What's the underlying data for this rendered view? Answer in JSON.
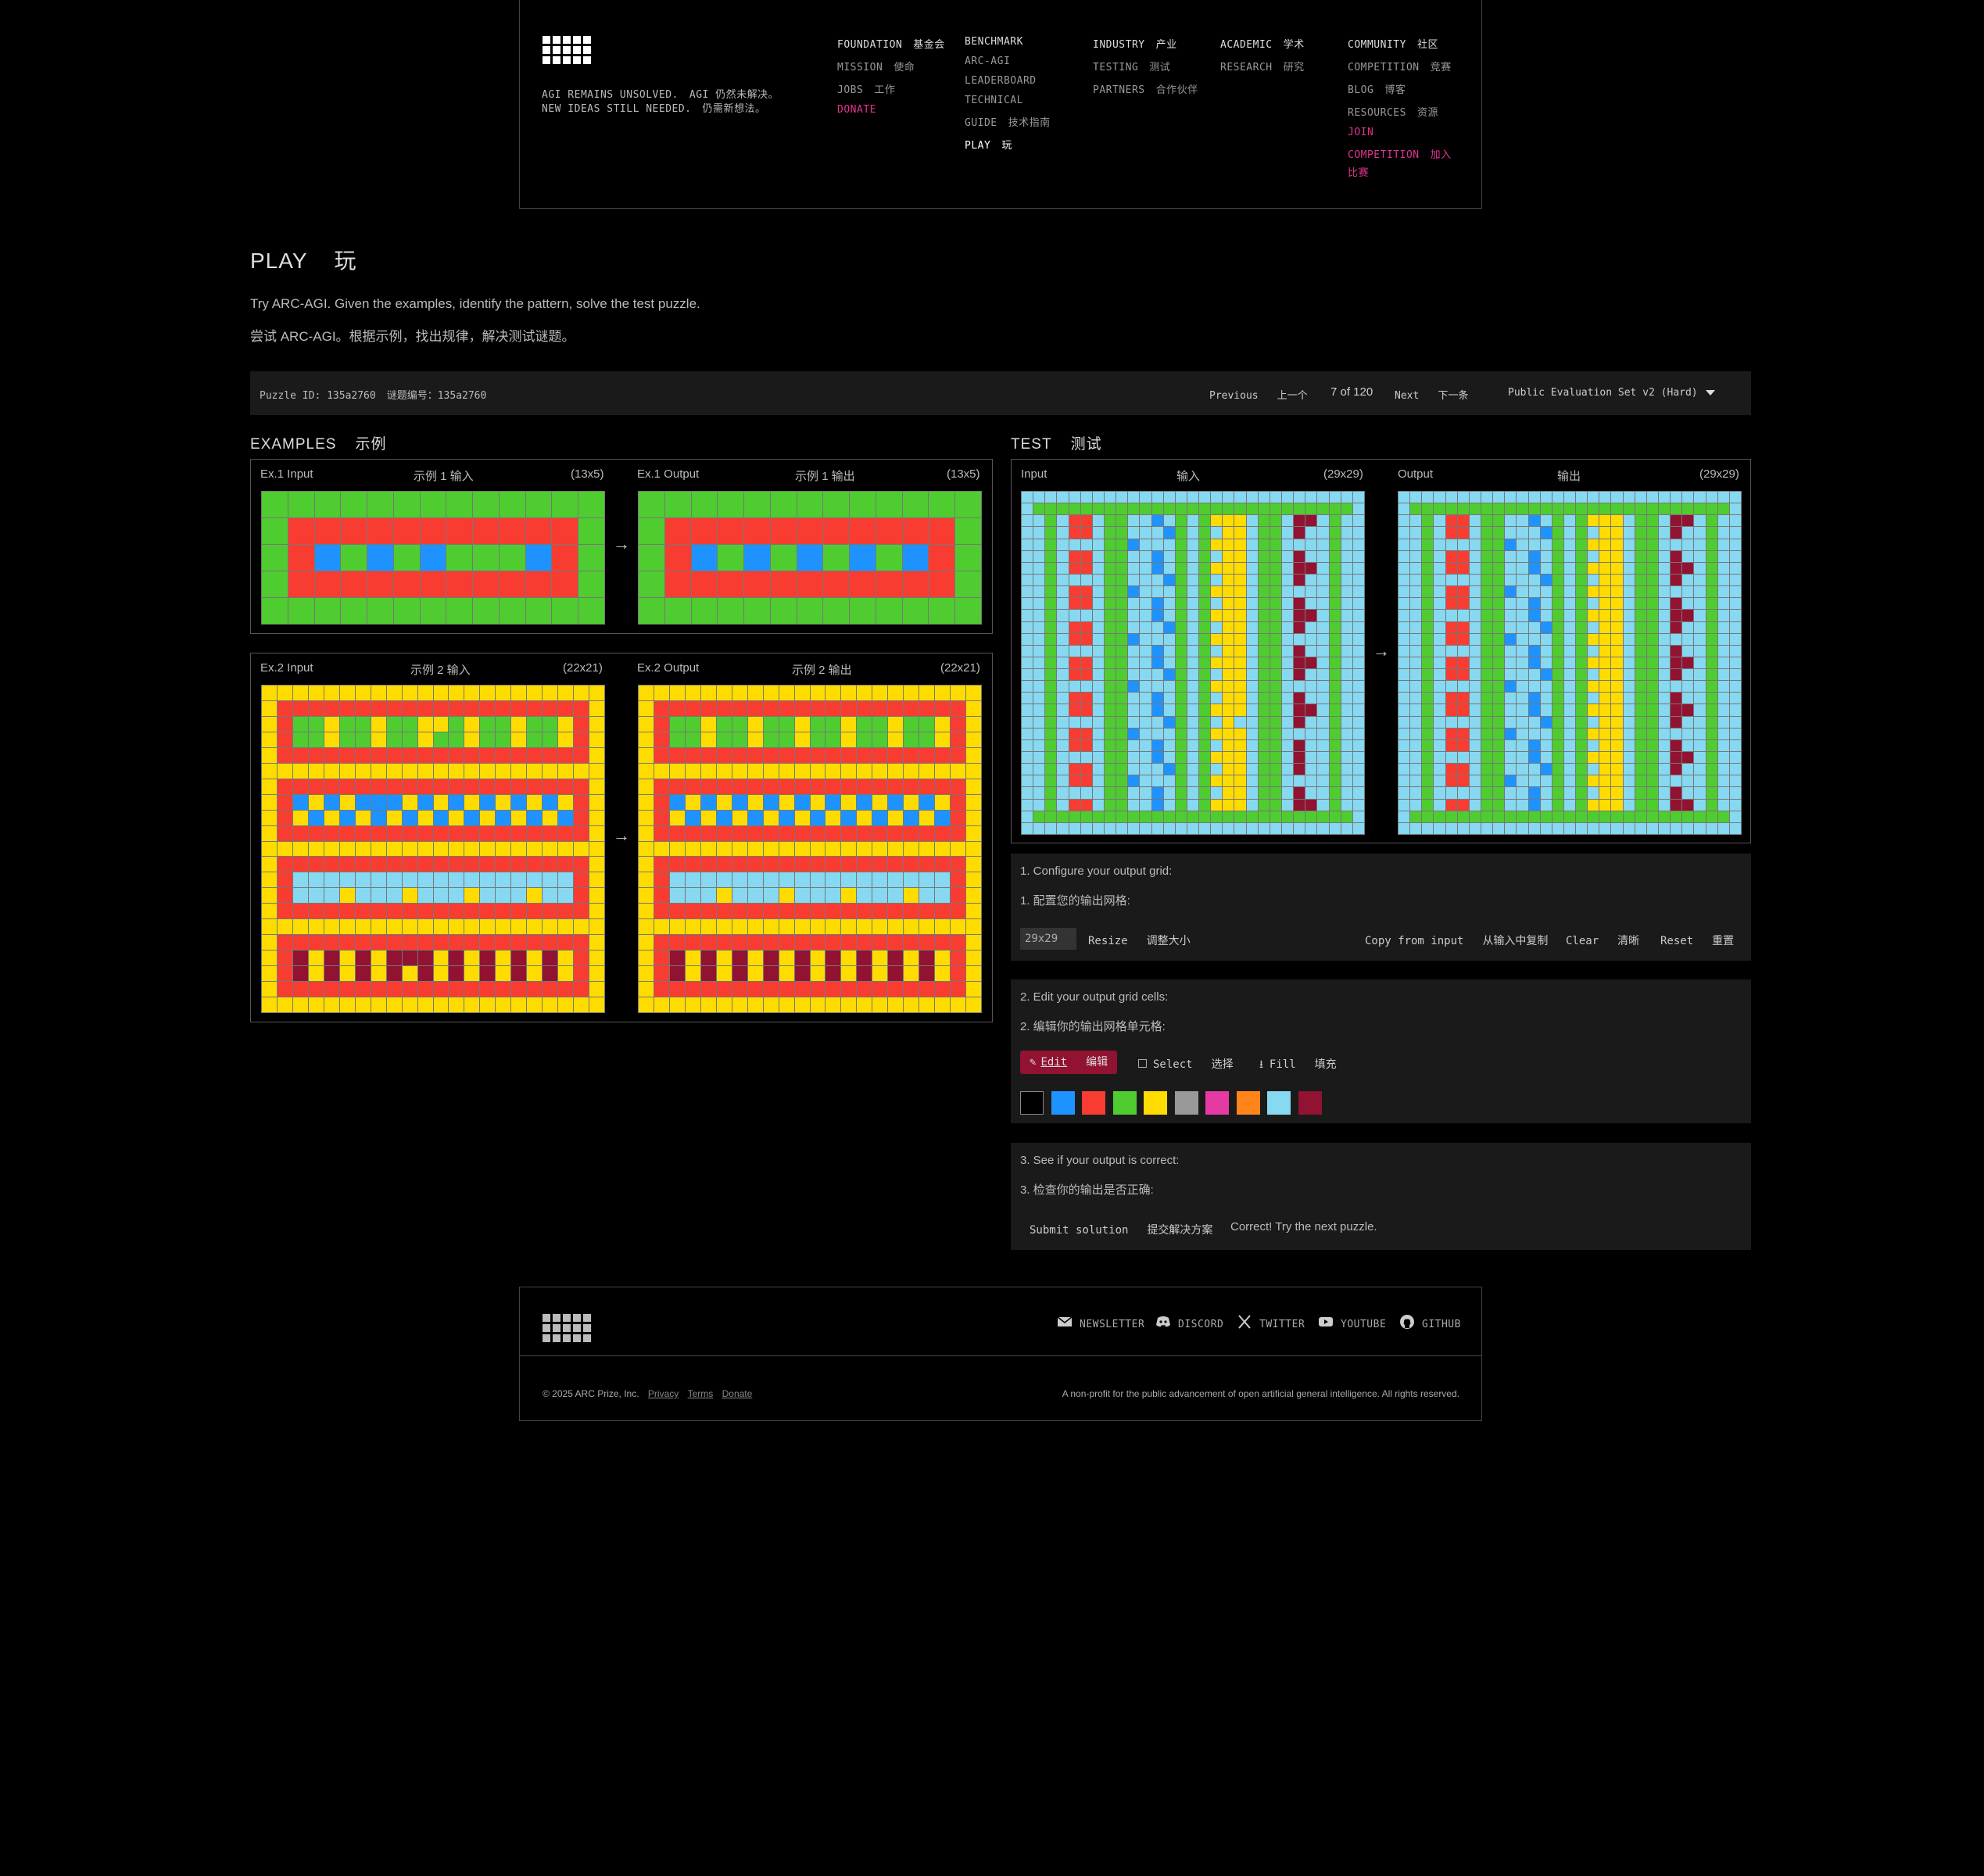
{
  "header": {
    "tagline_en_1": "AGI REMAINS UNSOLVED.",
    "tagline_zh_1": "AGI 仍然未解决。",
    "tagline_en_2": "NEW IDEAS STILL NEEDED.",
    "tagline_zh_2": "仍需新想法。",
    "nav": [
      {
        "heading": "FOUNDATION",
        "heading_zh": "基金会",
        "items": [
          {
            "label": "MISSION",
            "zh": "使命"
          },
          {
            "label": "JOBS",
            "zh": "工作"
          },
          {
            "label": "DONATE",
            "zh": ""
          }
        ]
      },
      {
        "heading": "BENCHMARK",
        "heading_zh": "",
        "items": [
          {
            "label": "ARC-AGI",
            "zh": ""
          },
          {
            "label": "LEADERBOARD",
            "zh": ""
          },
          {
            "label": "TECHNICAL",
            "zh": ""
          },
          {
            "label": "GUIDE",
            "zh": "技术指南"
          },
          {
            "label": "PLAY",
            "zh": "玩"
          }
        ]
      },
      {
        "heading": "INDUSTRY",
        "heading_zh": "产业",
        "items": [
          {
            "label": "TESTING",
            "zh": "测试"
          },
          {
            "label": "PARTNERS",
            "zh": "合作伙伴"
          }
        ]
      },
      {
        "heading": "ACADEMIC",
        "heading_zh": "学术",
        "items": [
          {
            "label": "RESEARCH",
            "zh": "研究"
          }
        ]
      },
      {
        "heading": "COMMUNITY",
        "heading_zh": "社区",
        "items": [
          {
            "label": "COMPETITION",
            "zh": "竞赛"
          },
          {
            "label": "BLOG",
            "zh": "博客"
          },
          {
            "label": "RESOURCES",
            "zh": "资源"
          },
          {
            "label": "JOIN",
            "zh": ""
          },
          {
            "label": "COMPETITION",
            "zh": "加入"
          },
          {
            "label": "比赛",
            "zh": ""
          }
        ]
      }
    ]
  },
  "page": {
    "title": "PLAY",
    "title_zh": "玩",
    "desc_en": "Try ARC-AGI. Given the examples, identify the pattern, solve the test puzzle.",
    "desc_zh": "尝试 ARC-AGI。根据示例，找出规律，解决测试谜题。"
  },
  "toolbar": {
    "puzzle_id": "Puzzle ID: 135a2760",
    "puzzle_id_zh": "谜题编号：135a2760",
    "previous": "Previous",
    "previous_zh": "上一个",
    "count": "7 of 120",
    "next": "Next",
    "next_zh": "下一条",
    "set": "Public Evaluation Set v2 (Hard)"
  },
  "examples": {
    "heading": "EXAMPLES",
    "heading_zh": "示例",
    "ex1_in": "Ex.1 Input",
    "ex1_in_zh": "示例 1 输入",
    "ex1_in_size": "(13x5)",
    "ex1_out": "Ex.1 Output",
    "ex1_out_zh": "示例 1 输出",
    "ex1_out_size": "(13x5)",
    "ex2_in": "Ex.2 Input",
    "ex2_in_zh": "示例 2 输入",
    "ex2_in_size": "(22x21)",
    "ex2_out": "Ex.2 Output",
    "ex2_out_zh": "示例 2 输出",
    "ex2_out_size": "(22x21)",
    "arrow": "→"
  },
  "test": {
    "heading": "TEST",
    "heading_zh": "测试",
    "in": "Input",
    "in_zh": "输入",
    "in_size": "(29x29)",
    "out": "Output",
    "out_zh": "输出",
    "out_size": "(29x29)",
    "arrow": "→"
  },
  "step1": {
    "title_en": "1. Configure your output grid:",
    "title_zh": "1. 配置您的输出网格:",
    "size_value": "29x29",
    "resize": "Resize",
    "resize_zh": "调整大小",
    "copy": "Copy from input",
    "copy_zh": "从输入中复制",
    "clear": "Clear",
    "clear_zh": "清晰",
    "reset": "Reset",
    "reset_zh": "重置"
  },
  "step2": {
    "title_en": "2. Edit your output grid cells:",
    "title_zh": "2. 编辑你的输出网格单元格:",
    "edit": "Edit",
    "edit_zh": "编辑",
    "select": "Select",
    "select_zh": "选择",
    "fill": "Fill",
    "fill_zh": "填充",
    "palette": [
      "#000000",
      "#1e93ff",
      "#f93c31",
      "#4fcc30",
      "#ffdc00",
      "#999999",
      "#e53aa3",
      "#ff851b",
      "#87d8f1",
      "#921231"
    ]
  },
  "step3": {
    "title_en": "3. See if your output is correct:",
    "title_zh": "3. 检查你的输出是否正确:",
    "submit": "Submit solution",
    "submit_zh": "提交解决方案",
    "status": "Correct! Try the next puzzle."
  },
  "footer": {
    "links": [
      "NEWSLETTER",
      "DISCORD",
      "TWITTER",
      "YOUTUBE",
      "GITHUB"
    ],
    "copyright": "© 2025 ARC Prize, Inc.",
    "privacy": "Privacy",
    "terms": "Terms",
    "donate": "Donate",
    "tagline": "A non-profit for the public advancement of open artificial general intelligence. All rights reserved."
  },
  "colors": {
    "green": "#4fcc30",
    "red": "#f93c31",
    "blue": "#1e93ff",
    "yellow": "#ffdc00",
    "lightblue": "#87d8f1",
    "maroon": "#921231",
    "pink": "#e0358f",
    "edit_bg": "#921231"
  }
}
